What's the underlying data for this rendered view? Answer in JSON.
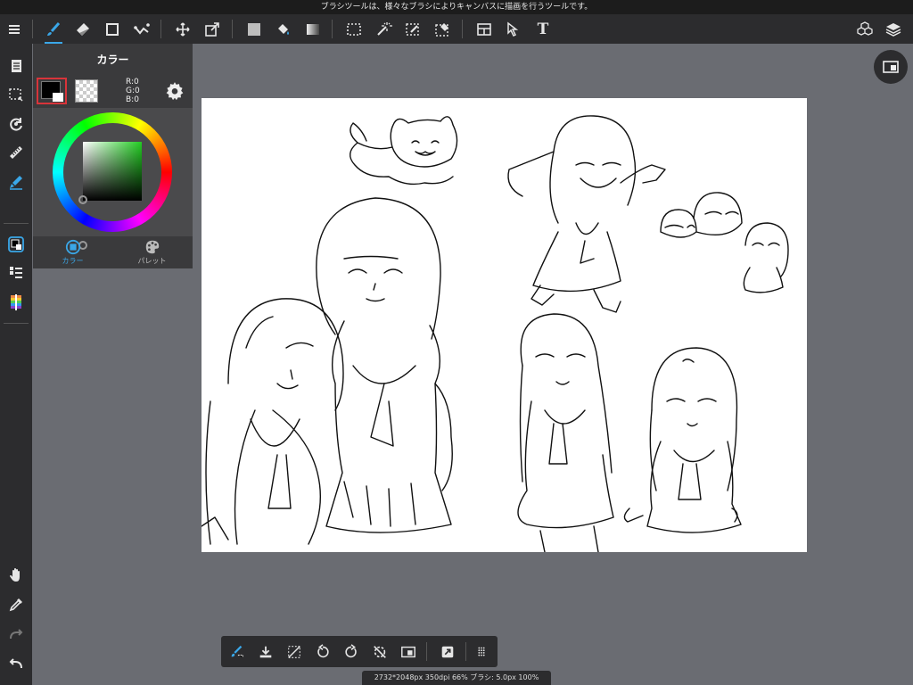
{
  "hint_bar": {
    "text": "ブラシツールは、様々なブラシによりキャンバスに描画を行うツールです。"
  },
  "toolbar": {
    "tools": [
      {
        "name": "menu-icon"
      },
      {
        "name": "brush-icon",
        "active": true
      },
      {
        "name": "eraser-icon"
      },
      {
        "name": "shape-icon"
      },
      {
        "name": "vector-pen-icon"
      },
      {
        "name": "move-icon"
      },
      {
        "name": "transform-icon"
      },
      {
        "name": "fill-icon"
      },
      {
        "name": "bucket-icon"
      },
      {
        "name": "gradient-icon"
      },
      {
        "name": "select-rect-icon"
      },
      {
        "name": "magic-wand-icon"
      },
      {
        "name": "select-pen-icon"
      },
      {
        "name": "select-eraser-icon"
      },
      {
        "name": "frame-divider-icon"
      },
      {
        "name": "operation-icon"
      },
      {
        "name": "text-icon"
      },
      {
        "name": "3d-icon"
      },
      {
        "name": "layers-icon"
      }
    ],
    "text_tool_glyph": "T"
  },
  "color_panel": {
    "title": "カラー",
    "foreground": "#000000",
    "r_label": "R:0",
    "g_label": "G:0",
    "b_label": "B:0",
    "tabs": [
      {
        "label": "カラー",
        "active": true
      },
      {
        "label": "パレット",
        "active": false
      }
    ]
  },
  "status_bar": {
    "text": "2732*2048px 350dpi 66% ブラシ: 5.0px 100%"
  },
  "colors": {
    "toolbar_bg": "#2c2c2e",
    "workspace_bg": "#6a6c72",
    "accent": "#3aa7e8",
    "swatch_border": "#d8343a"
  }
}
